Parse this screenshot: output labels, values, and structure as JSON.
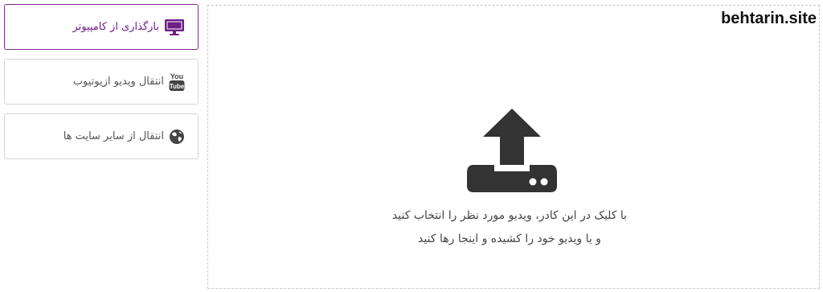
{
  "sidebar": {
    "items": [
      {
        "label": "بارگذاری از کامپیوتر",
        "icon": "monitor-icon",
        "active": true
      },
      {
        "label": "انتقال ویدیو ازیوتیوب",
        "icon": "youtube-icon",
        "active": false
      },
      {
        "label": "انتقال از سایر سایت ها",
        "icon": "globe-icon",
        "active": false
      }
    ]
  },
  "youtube_icon_text": {
    "top": "You",
    "bottom": "Tube"
  },
  "dropzone": {
    "watermark": "behtarin.site",
    "icon": "upload-icon",
    "line1": "با کلیک در این کادر، ویدیو مورد نظر را انتخاب کنید",
    "line2": "و یا ویدیو خود را کشیده و اینجا رها کنید"
  },
  "colors": {
    "accent": "#6d1f86",
    "icon_dark": "#333333",
    "border": "#d6d6d6"
  }
}
